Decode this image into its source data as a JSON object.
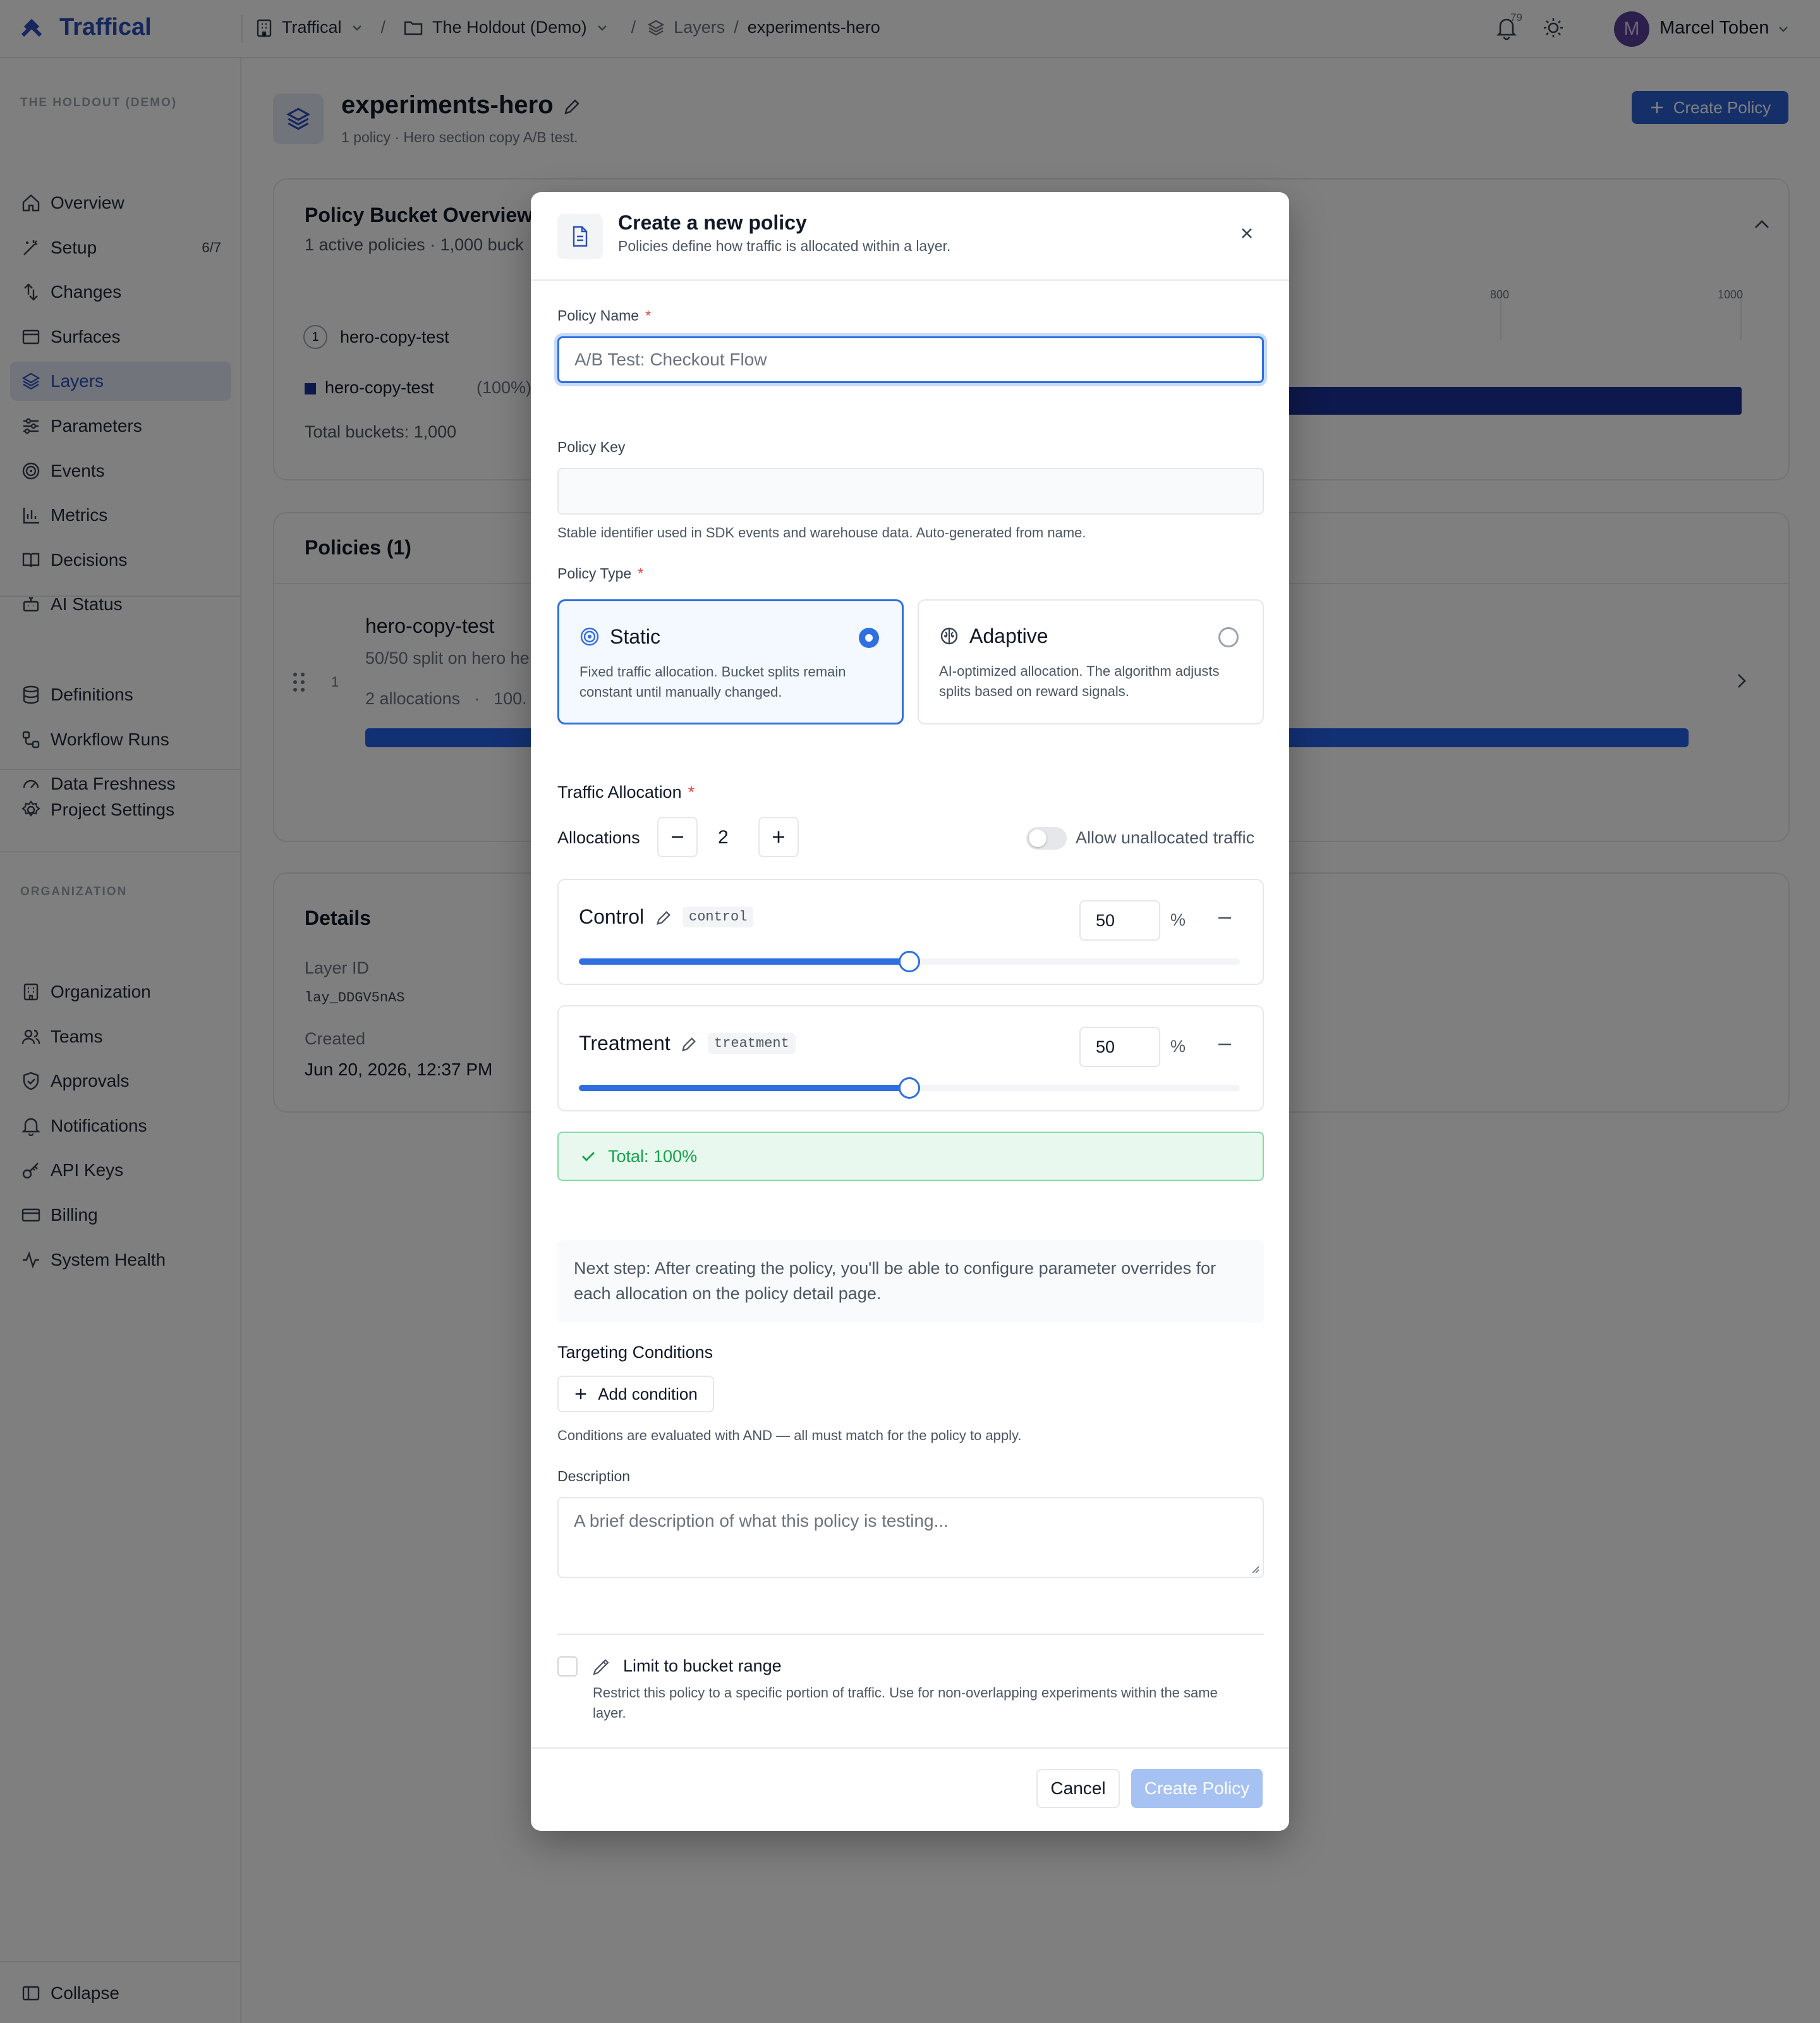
{
  "topbar": {
    "brand": "Traffical",
    "crumb_org": "Traffical",
    "crumb_project": "The Holdout (Demo)",
    "crumb_layers": "Layers",
    "crumb_current": "experiments-hero",
    "notif_count": "79",
    "user_initial": "M",
    "user_name": "Marcel Toben"
  },
  "sidebar": {
    "group_project": "THE HOLDOUT (DEMO)",
    "items": [
      {
        "label": "Overview",
        "icon": "home-icon"
      },
      {
        "label": "Setup",
        "icon": "wand-icon",
        "badge": "6/7"
      },
      {
        "label": "Changes",
        "icon": "changes-icon"
      },
      {
        "label": "Surfaces",
        "icon": "window-icon"
      },
      {
        "label": "Layers",
        "icon": "layers-icon",
        "active": true
      },
      {
        "label": "Parameters",
        "icon": "sliders-icon"
      },
      {
        "label": "Events",
        "icon": "target-icon"
      },
      {
        "label": "Metrics",
        "icon": "bar-chart-icon"
      },
      {
        "label": "Decisions",
        "icon": "book-icon"
      },
      {
        "label": "AI Status",
        "icon": "bot-icon"
      }
    ],
    "items_data": [
      {
        "label": "Definitions",
        "icon": "database-icon"
      },
      {
        "label": "Workflow Runs",
        "icon": "workflow-icon"
      },
      {
        "label": "Data Freshness",
        "icon": "gauge-icon"
      }
    ],
    "project_settings": "Project Settings",
    "group_org": "ORGANIZATION",
    "items_org": [
      {
        "label": "Organization",
        "icon": "building-icon"
      },
      {
        "label": "Teams",
        "icon": "users-icon"
      },
      {
        "label": "Approvals",
        "icon": "shield-check-icon"
      },
      {
        "label": "Notifications",
        "icon": "bell-icon"
      },
      {
        "label": "API Keys",
        "icon": "key-icon"
      },
      {
        "label": "Billing",
        "icon": "credit-card-icon"
      },
      {
        "label": "System Health",
        "icon": "activity-icon"
      }
    ],
    "collapse": "Collapse"
  },
  "page": {
    "title": "experiments-hero",
    "subtitle": "1 policy · Hero section copy A/B test.",
    "create_button": "Create Policy",
    "bucket_overview_title": "Policy Bucket Overview",
    "bucket_overview_sub": "1 active policies · 1,000 buck",
    "legend_policy_num": "1",
    "legend_policy_name": "hero-copy-test",
    "legend_entry_name": "hero-copy-test",
    "legend_entry_pct": "(100%)",
    "total_buckets": "Total buckets: 1,000",
    "axis_ticks": [
      "800",
      "1000"
    ],
    "policies_title": "Policies (1)",
    "policy_name": "hero-copy-test",
    "policy_desc": "50/50 split on hero he",
    "policy_index": "1",
    "policy_allocations": "2 allocations",
    "policy_meta_dot": "·",
    "policy_meta_pct": "100.",
    "details_title": "Details",
    "layer_id_label": "Layer ID",
    "layer_id_value": "lay_DDGV5nAS",
    "created_label": "Created",
    "created_value": "Jun 20, 2026, 12:37 PM"
  },
  "modal": {
    "title": "Create a new policy",
    "subtitle": "Policies define how traffic is allocated within a layer.",
    "name_label": "Policy Name",
    "required_mark": "*",
    "name_placeholder": "A/B Test: Checkout Flow",
    "key_label": "Policy Key",
    "key_placeholder": "",
    "key_help": "Stable identifier used in SDK events and warehouse data. Auto-generated from name.",
    "type_label": "Policy Type",
    "type_static_title": "Static",
    "type_static_desc": "Fixed traffic allocation. Bucket splits remain constant until manually changed.",
    "type_adaptive_title": "Adaptive",
    "type_adaptive_desc": "AI-optimized allocation. The algorithm adjusts splits based on reward signals.",
    "selected_type": "Static",
    "traffic_label": "Traffic Allocation",
    "allocations_label": "Allocations",
    "allocations_count": "2",
    "allow_unallocated": "Allow unallocated traffic",
    "allow_unallocated_on": false,
    "allocations": [
      {
        "name": "Control",
        "key": "control",
        "value": "50",
        "fraction": 0.5
      },
      {
        "name": "Treatment",
        "key": "treatment",
        "value": "50",
        "fraction": 0.5
      }
    ],
    "percent_sign": "%",
    "total": "Total: 100%",
    "next_step": "Next step: After creating the policy, you'll be able to configure parameter overrides for each allocation on the policy detail page.",
    "targeting_label": "Targeting Conditions",
    "add_condition": "Add condition",
    "conditions_help": "Conditions are evaluated with AND — all must match for the policy to apply.",
    "description_label": "Description",
    "description_placeholder": "A brief description of what this policy is testing...",
    "bucket_range_label": "Limit to bucket range",
    "bucket_range_help": "Restrict this policy to a specific portion of traffic. Use for non-overlapping experiments within the same layer.",
    "cancel": "Cancel",
    "create": "Create Policy"
  },
  "colors": {
    "brand": "#2b4fb8",
    "primary": "#2f6fe0",
    "bar_dark": "#1a3399",
    "success_bg": "#e8f8ee",
    "success_text": "#16a34a",
    "create_disabled": "#a6c2f2"
  }
}
